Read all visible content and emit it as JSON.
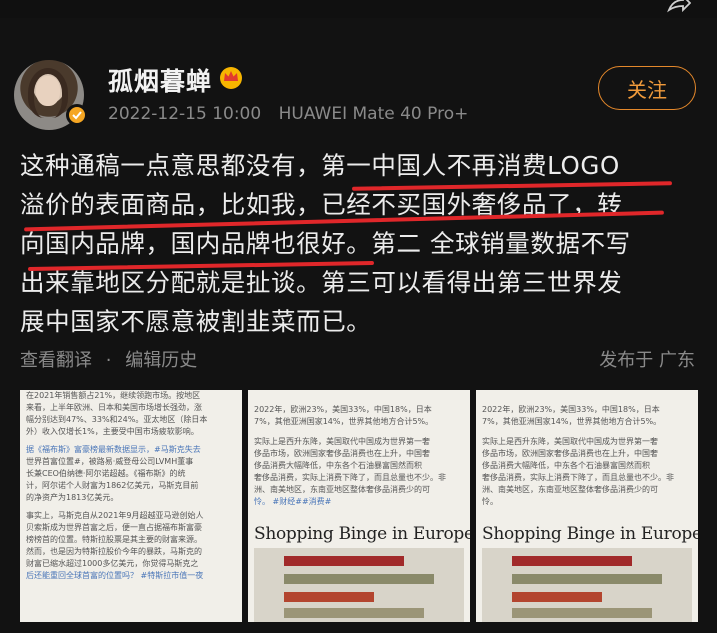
{
  "user": {
    "name": "孤烟暮蝉",
    "date": "2022-12-15 10:00",
    "device": "HUAWEI Mate 40 Pro+",
    "follow_label": "关注"
  },
  "post": {
    "lines": [
      "这种通稿一点意思都没有，第一中国人不再消费LOGO",
      "溢价的表面商品，比如我，已经不买国外奢侈品了，转",
      "向国内品牌，国内品牌也很好。第二 全球销量数据不写",
      "出来靠地区分配就是扯谈。第三可以看得出第三世界发",
      "展中国家不愿意被割韭菜而已。"
    ]
  },
  "actions": {
    "translate": "查看翻译",
    "separator": "·",
    "history": "编辑历史",
    "location": "发布于 广东"
  },
  "images": {
    "thumb1": {
      "lines": [
        "在2021年销售额占21%，继续领跑市场。按地区",
        "来看，上半年欧洲、日本和美国市场增长强劲，涨",
        "幅分别达到47%、33%和24%。亚太地区（除日本",
        "外）收入仅增长1%，主要受中国市场疲软影响。",
        "",
        "据《福布斯》富豪榜最新数据显示，#马斯克失去",
        "世界首富位置#，被路易·威登母公司LVMH董事",
        "长兼CEO伯纳德·阿尔诺超越。《福布斯》的统",
        "计，阿尔诺个人财富为1862亿美元，马斯克目前",
        "的净资产为1813亿美元。",
        "",
        "事实上，马斯克自从2021年9月超越亚马逊创始人",
        "贝索斯成为世界首富之后，便一直占据福布斯富豪",
        "榜榜首的位置。特斯拉股票是其主要的财富来源。",
        "然而，也是因为特斯拉股价今年的暴跌，马斯克的",
        "财富已缩水超过1000多亿美元，你觉得马斯克之",
        "后还能重回全球首富的位置吗？ #特斯拉市值一夜"
      ]
    },
    "thumb2": {
      "lines": [
        "2022年，欧洲23%，美国33%，中国18%，日本",
        "7%，其他亚洲国家14%，世界其他地方合计5%。",
        "",
        "实际上是西升东降，美国取代中国成为世界第一奢",
        "侈品市场，欧洲国家奢侈品消费也在上升，中国奢",
        "侈品消费大幅降低，中东各个石油暴富国然而积",
        "奢侈品消费，实际上消费下降了，而且总量也不少。非",
        "洲、南美地区，东南亚地区整体奢侈品消费少的可",
        "怜。 #财经##消费#"
      ],
      "headline": "Shopping Binge in Europe"
    },
    "thumb3": {
      "lines": [
        "2022年，欧洲23%，美国33%，中国18%，日本",
        "7%，其他亚洲国家14%，世界其他地方合计5%。",
        "",
        "实际上是西升东降，美国取代中国成为世界第一奢",
        "侈品市场，欧洲国家奢侈品消费也在上升，中国奢",
        "侈品消费大幅降低，中东各个石油暴富国然而积",
        "奢侈品消费，实际上消费下降了，而且总量也不少。非",
        "洲、南美地区，东南亚地区整体奢侈品消费少的可",
        "怜。"
      ],
      "headline": "Shopping Binge in Europe"
    }
  },
  "colors": {
    "accent": "#f09a3b",
    "underline": "#e0272a",
    "background": "#121212"
  }
}
